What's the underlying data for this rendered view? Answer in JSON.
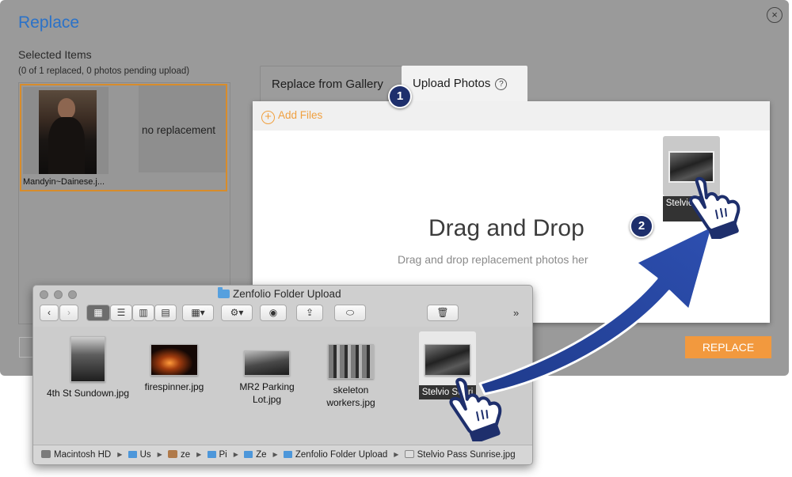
{
  "dialog": {
    "title": "Replace",
    "close_icon": "×",
    "selected_title": "Selected Items",
    "selected_subtitle": "(0 of 1 replaced, 0 photos pending upload)",
    "item_filename": "Mandyin~Dainese.j...",
    "no_replacement": "no replacement",
    "replace_button": "REPLACE",
    "accent_color": "#f2993e",
    "title_color": "#2b72c8"
  },
  "tabs": {
    "gallery": "Replace from Gallery",
    "upload": "Upload Photos",
    "help_icon": "?"
  },
  "upload": {
    "add_files": "Add Files",
    "add_icon": "+",
    "drag_title": "Drag and Drop",
    "drag_subtitle": "Drag and drop replacement photos her",
    "drag_card_label": "Stelvio Sunri"
  },
  "steps": {
    "one": "1",
    "two": "2"
  },
  "finder": {
    "title": "Zenfolio Folder Upload",
    "more": "»",
    "files": [
      {
        "name": "4th St Sundown.jpg"
      },
      {
        "name": "firespinner.jpg"
      },
      {
        "name": "MR2 Parking Lot.jpg"
      },
      {
        "name": "skeleton workers.jpg"
      },
      {
        "name": "Stelvio Sunri"
      }
    ],
    "path": [
      "Macintosh HD",
      "Us",
      "ze",
      "Pi",
      "Ze",
      "Zenfolio Folder Upload",
      "Stelvio Pass Sunrise.jpg"
    ]
  }
}
